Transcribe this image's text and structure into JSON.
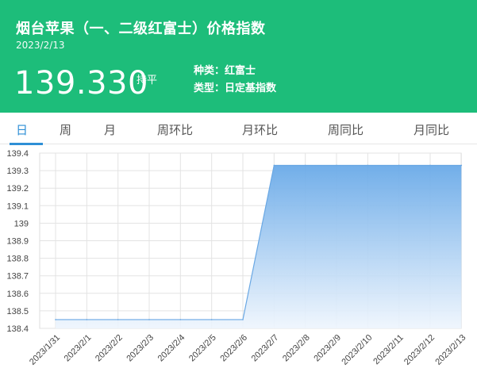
{
  "header": {
    "title": "烟台苹果（一、二级红富士）价格指数",
    "date": "2023/2/13",
    "value": "139.330",
    "trend": "持平",
    "category": "种类：红富士",
    "index_type": "类型：日定基指数"
  },
  "tabs": [
    {
      "label": "日",
      "active": true
    },
    {
      "label": "周",
      "active": false
    },
    {
      "label": "月",
      "active": false
    },
    {
      "label": "周环比",
      "active": false
    },
    {
      "label": "月环比",
      "active": false
    },
    {
      "label": "周同比",
      "active": false
    },
    {
      "label": "月同比",
      "active": false
    }
  ],
  "colors": {
    "header_bg": "#1dbd7a",
    "accent": "#2e8fd6",
    "line": "#6aa8e4",
    "fill_top": "#6aaae8",
    "fill_bottom": "#eef5fd"
  },
  "chart_data": {
    "type": "area",
    "x": [
      "2023/1/31",
      "2023/2/1",
      "2023/2/2",
      "2023/2/3",
      "2023/2/4",
      "2023/2/5",
      "2023/2/6",
      "2023/2/7",
      "2023/2/8",
      "2023/2/9",
      "2023/2/10",
      "2023/2/11",
      "2023/2/12",
      "2023/2/13"
    ],
    "values": [
      138.45,
      138.45,
      138.45,
      138.45,
      138.45,
      138.45,
      138.45,
      139.33,
      139.33,
      139.33,
      139.33,
      139.33,
      139.33,
      139.33
    ],
    "y_ticks": [
      "138.4",
      "138.5",
      "138.6",
      "138.7",
      "138.8",
      "138.9",
      "139",
      "139.1",
      "139.2",
      "139.3",
      "139.4"
    ],
    "ylim": [
      138.4,
      139.4
    ],
    "grid": true
  }
}
